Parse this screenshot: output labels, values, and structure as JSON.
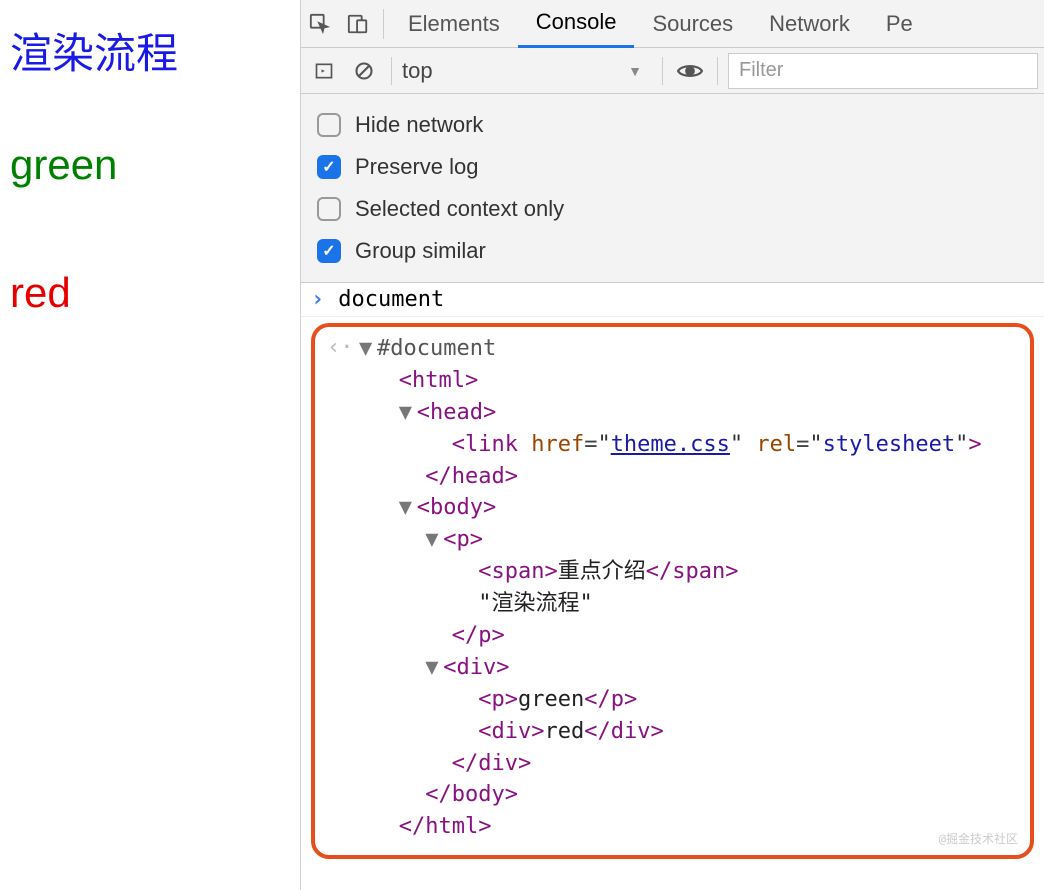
{
  "page": {
    "title": "渲染流程",
    "green_text": "green",
    "red_text": "red"
  },
  "tabs": {
    "elements": "Elements",
    "console": "Console",
    "sources": "Sources",
    "network": "Network",
    "performance": "Pe"
  },
  "toolbar": {
    "context": "top",
    "context_dropdown": "▼",
    "filter_placeholder": "Filter"
  },
  "settings": {
    "hide_network": {
      "label": "Hide network",
      "checked": false
    },
    "preserve_log": {
      "label": "Preserve log",
      "checked": true
    },
    "selected_context": {
      "label": "Selected context only",
      "checked": false
    },
    "group_similar": {
      "label": "Group similar",
      "checked": true
    }
  },
  "console": {
    "input_marker": "›",
    "input_cmd": "document",
    "output_marker": "‹·",
    "doc_label": "#document",
    "html_open": "html",
    "head_open": "head",
    "link_tag": "link",
    "link_href_attr": "href",
    "link_href_val": "theme.css",
    "link_rel_attr": "rel",
    "link_rel_val": "stylesheet",
    "head_close": "head",
    "body_open": "body",
    "p_open": "p",
    "span_tag": "span",
    "span_text": "重点介绍",
    "p_text": "\"渲染流程\"",
    "p_close": "p",
    "div_open": "div",
    "inner_p": "p",
    "inner_p_text": "green",
    "inner_div": "div",
    "inner_div_text": "red",
    "div_close": "div",
    "body_close": "body",
    "html_close": "html"
  },
  "watermark": "@掘金技术社区"
}
